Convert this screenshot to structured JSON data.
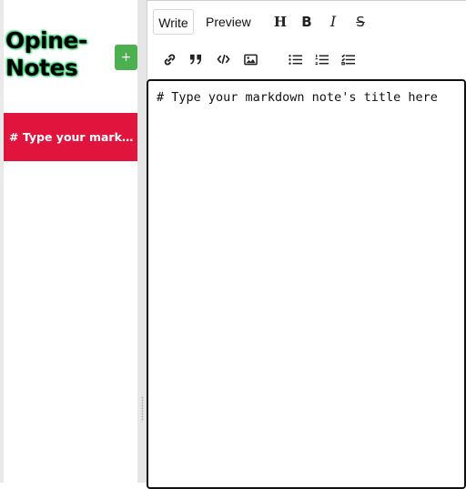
{
  "sidebar": {
    "title_line1": "Opine-",
    "title_line2": "Notes",
    "add_button_label": "+",
    "notes": [
      {
        "label": "# Type your markdown note's title here"
      }
    ]
  },
  "editor": {
    "tabs": {
      "write": "Write",
      "preview": "Preview"
    },
    "active_tab": "Write",
    "toolbar": {
      "header": "H",
      "bold": "B",
      "italic": "I",
      "strikethrough": "S"
    },
    "content": "# Type your markdown note's title here"
  },
  "colors": {
    "accent_note": "#e0143c",
    "add_button": "#4caf50",
    "title_glow": "#22c55e"
  }
}
